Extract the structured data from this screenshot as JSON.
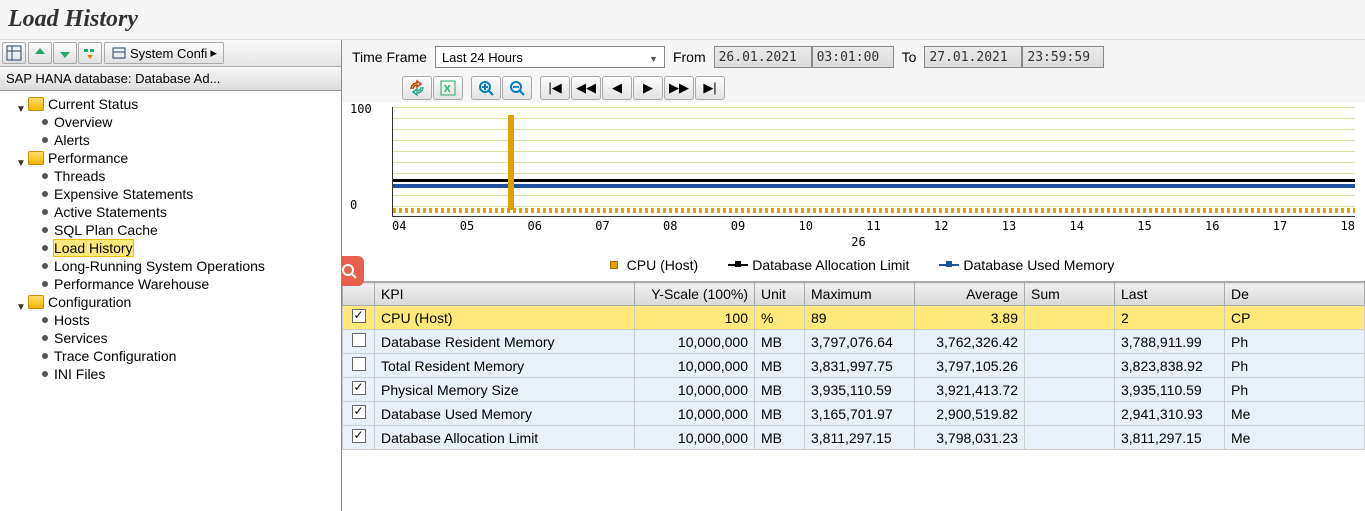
{
  "title": "Load History",
  "toolbar": {
    "sysconfi": "System Confi"
  },
  "tree_header": "SAP HANA database: Database Ad...",
  "tree": {
    "current_status": "Current Status",
    "overview": "Overview",
    "alerts": "Alerts",
    "performance": "Performance",
    "threads": "Threads",
    "expensive_statements": "Expensive Statements",
    "active_statements": "Active Statements",
    "sql_plan_cache": "SQL Plan Cache",
    "load_history": "Load History",
    "long_running": "Long-Running System Operations",
    "perf_warehouse": "Performance Warehouse",
    "configuration": "Configuration",
    "hosts": "Hosts",
    "services": "Services",
    "trace_config": "Trace Configuration",
    "ini_files": "INI Files"
  },
  "timeframe": {
    "label": "Time Frame",
    "value": "Last 24 Hours",
    "from_label": "From",
    "from_date": "26.01.2021",
    "from_time": "03:01:00",
    "to_label": "To",
    "to_date": "27.01.2021",
    "to_time": "23:59:59"
  },
  "chart_data": {
    "type": "line",
    "title": "",
    "ylim": [
      0,
      100
    ],
    "y_ticks": [
      "100",
      "0"
    ],
    "x_ticks": [
      "04",
      "05",
      "06",
      "07",
      "08",
      "09",
      "10",
      "11",
      "12",
      "13",
      "14",
      "15",
      "16",
      "17",
      "18"
    ],
    "x_sub": "26",
    "series": [
      {
        "name": "CPU (Host)",
        "color": "#e0a000",
        "marker": "square",
        "pattern": "low-scatter-with-spike"
      },
      {
        "name": "Database Allocation Limit",
        "color": "#000000",
        "marker": "square",
        "pattern": "flat-38"
      },
      {
        "name": "Database Used Memory",
        "color": "#2050a0",
        "marker": "square",
        "pattern": "flat-29"
      }
    ]
  },
  "table": {
    "headers": {
      "kpi": "KPI",
      "yscale": "Y-Scale (100%)",
      "unit": "Unit",
      "maximum": "Maximum",
      "average": "Average",
      "sum": "Sum",
      "last": "Last",
      "de": "De"
    },
    "rows": [
      {
        "checked": true,
        "selected": true,
        "kpi": "CPU (Host)",
        "yscale": "100",
        "unit": "%",
        "max": "89",
        "avg": "3.89",
        "sum": "",
        "last": "2",
        "de": "CP"
      },
      {
        "checked": false,
        "kpi": "Database Resident Memory",
        "yscale": "10,000,000",
        "unit": "MB",
        "max": "3,797,076.64",
        "avg": "3,762,326.42",
        "sum": "",
        "last": "3,788,911.99",
        "de": "Ph"
      },
      {
        "checked": false,
        "kpi": "Total Resident Memory",
        "yscale": "10,000,000",
        "unit": "MB",
        "max": "3,831,997.75",
        "avg": "3,797,105.26",
        "sum": "",
        "last": "3,823,838.92",
        "de": "Ph"
      },
      {
        "checked": true,
        "kpi": "Physical Memory Size",
        "yscale": "10,000,000",
        "unit": "MB",
        "max": "3,935,110.59",
        "avg": "3,921,413.72",
        "sum": "",
        "last": "3,935,110.59",
        "de": "Ph"
      },
      {
        "checked": true,
        "kpi": "Database Used Memory",
        "yscale": "10,000,000",
        "unit": "MB",
        "max": "3,165,701.97",
        "avg": "2,900,519.82",
        "sum": "",
        "last": "2,941,310.93",
        "de": "Me"
      },
      {
        "checked": true,
        "kpi": "Database Allocation Limit",
        "yscale": "10,000,000",
        "unit": "MB",
        "max": "3,811,297.15",
        "avg": "3,798,031.23",
        "sum": "",
        "last": "3,811,297.15",
        "de": "Me"
      }
    ]
  }
}
